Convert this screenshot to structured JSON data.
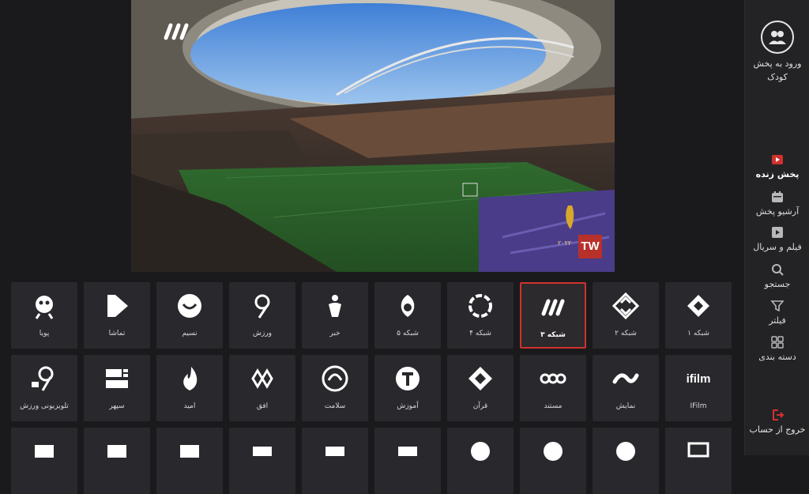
{
  "sidebar": {
    "kids_label_line1": "ورود به پخش",
    "kids_label_line2": "کودک",
    "items": [
      {
        "label": "پخش زنده",
        "icon": "live-play-icon",
        "active": true
      },
      {
        "label": "آرشیو پخش",
        "icon": "calendar-icon",
        "active": false
      },
      {
        "label": "فیلم و سریال",
        "icon": "film-icon",
        "active": false
      },
      {
        "label": "جستجو",
        "icon": "search-icon",
        "active": false
      },
      {
        "label": "فیلتر",
        "icon": "filter-icon",
        "active": false
      },
      {
        "label": "دسته بندی",
        "icon": "grid-icon",
        "active": false
      }
    ],
    "logout_label": "خروج از حساب",
    "accent_color": "#d0312d"
  },
  "player": {
    "watermark_badge": "TW",
    "event_year": "۲۰۲۲"
  },
  "channels_row1": [
    {
      "label": "شبکه ۱",
      "icon": "channel-1-logo-icon"
    },
    {
      "label": "شبکه ۲",
      "icon": "channel-2-logo-icon"
    },
    {
      "label": "شبکه ۳",
      "icon": "channel-3-logo-icon",
      "selected": true
    },
    {
      "label": "شبکه ۴",
      "icon": "channel-4-logo-icon"
    },
    {
      "label": "شبکه ۵",
      "icon": "channel-5-logo-icon"
    },
    {
      "label": "خبر",
      "icon": "khabar-logo-icon"
    },
    {
      "label": "ورزش",
      "icon": "varzesh-logo-icon"
    },
    {
      "label": "نسیم",
      "icon": "nasim-logo-icon"
    },
    {
      "label": "تماشا",
      "icon": "tamasha-logo-icon"
    },
    {
      "label": "پویا",
      "icon": "pooya-logo-icon"
    }
  ],
  "channels_row2": [
    {
      "label": "IFilm",
      "logo_text": "ifilm",
      "icon": "ifilm-logo-icon"
    },
    {
      "label": "نمایش",
      "icon": "namayesh-logo-icon"
    },
    {
      "label": "مستند",
      "icon": "mostanad-logo-icon"
    },
    {
      "label": "قرآن",
      "icon": "quran-logo-icon"
    },
    {
      "label": "آموزش",
      "icon": "amoozesh-logo-icon"
    },
    {
      "label": "سلامت",
      "icon": "salamat-logo-icon"
    },
    {
      "label": "افق",
      "icon": "ofogh-logo-icon"
    },
    {
      "label": "امید",
      "icon": "omid-logo-icon"
    },
    {
      "label": "سپهر",
      "icon": "sepehr-logo-icon"
    },
    {
      "label": "تلویزیونی ورزش",
      "icon": "varzesh-tv-logo-icon"
    }
  ],
  "channels_row3": [
    {
      "label": "",
      "icon": "channel-logo-icon"
    },
    {
      "label": "",
      "icon": "channel-logo-icon"
    },
    {
      "label": "",
      "icon": "channel-logo-icon"
    },
    {
      "label": "",
      "icon": "channel-logo-icon"
    },
    {
      "label": "",
      "icon": "channel-logo-icon"
    },
    {
      "label": "",
      "icon": "channel-logo-icon"
    },
    {
      "label": "",
      "icon": "channel-logo-icon"
    },
    {
      "label": "",
      "icon": "channel-logo-icon"
    },
    {
      "label": "",
      "icon": "channel-logo-icon"
    },
    {
      "label": "",
      "icon": "channel-logo-icon"
    }
  ]
}
